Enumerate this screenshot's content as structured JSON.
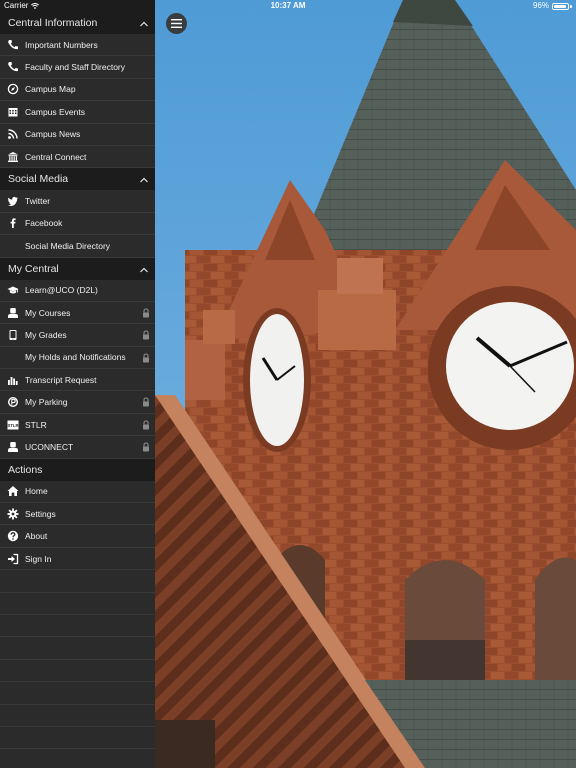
{
  "status_bar": {
    "carrier": "Carrier",
    "time": "10:37 AM",
    "battery": "96%",
    "battery_level": 0.96
  },
  "sections": [
    {
      "title": "Central Information",
      "items": [
        {
          "label": "Important Numbers",
          "icon": "phone-icon"
        },
        {
          "label": "Faculty and Staff Directory",
          "icon": "phone-icon"
        },
        {
          "label": "Campus Map",
          "icon": "compass-icon"
        },
        {
          "label": "Campus Events",
          "icon": "calendar-icon"
        },
        {
          "label": "Campus News",
          "icon": "rss-icon"
        },
        {
          "label": "Central Connect",
          "icon": "institution-icon"
        }
      ]
    },
    {
      "title": "Social Media",
      "items": [
        {
          "label": "Twitter",
          "icon": "twitter-icon"
        },
        {
          "label": "Facebook",
          "icon": "facebook-icon"
        },
        {
          "label": "Social Media Directory",
          "icon": ""
        }
      ]
    },
    {
      "title": "My Central",
      "items": [
        {
          "label": "Learn@UCO (D2L)",
          "icon": "graduation-cap-icon",
          "locked": false
        },
        {
          "label": "My Courses",
          "icon": "user-icon",
          "locked": true
        },
        {
          "label": "My Grades",
          "icon": "tablet-icon",
          "locked": true
        },
        {
          "label": "My Holds and Notifications",
          "icon": "",
          "locked": true
        },
        {
          "label": "Transcript Request",
          "icon": "bar-chart-icon",
          "locked": false
        },
        {
          "label": "My Parking",
          "icon": "parking-icon",
          "locked": true
        },
        {
          "label": "STLR",
          "icon": "stlr-icon",
          "locked": true
        },
        {
          "label": "UCONNECT",
          "icon": "user-icon",
          "locked": true
        }
      ]
    },
    {
      "title": "Actions",
      "items": [
        {
          "label": "Home",
          "icon": "home-icon"
        },
        {
          "label": "Settings",
          "icon": "gear-icon"
        },
        {
          "label": "About",
          "icon": "question-icon"
        },
        {
          "label": "Sign In",
          "icon": "sign-in-icon"
        }
      ]
    }
  ],
  "colors": {
    "sidebar_bg": "#2b2b2b",
    "header_bg": "#1c1c1c",
    "divider": "#393939",
    "sky": "#5aa0d6"
  }
}
